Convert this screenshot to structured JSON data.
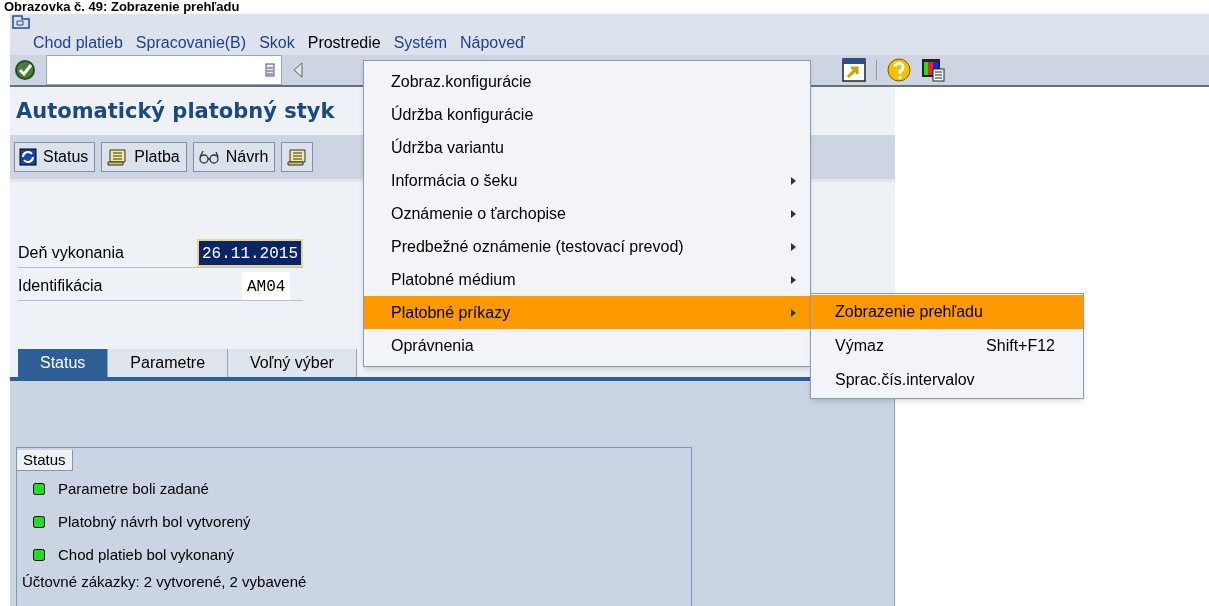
{
  "caption": "Obrazovka č. 49: Zobrazenie prehľadu",
  "menubar": [
    {
      "label": "Chod platieb",
      "selected": false
    },
    {
      "label": "Spracovanie(B)",
      "selected": false
    },
    {
      "label": "Skok",
      "selected": false
    },
    {
      "label": "Prostredie",
      "selected": true
    },
    {
      "label": "Systém",
      "selected": false
    },
    {
      "label": "Nápoveď",
      "selected": false
    }
  ],
  "title": "Automatický platobný styk",
  "buttons": [
    {
      "kind": "refresh",
      "label": "Status"
    },
    {
      "kind": "scroll",
      "label": "Platba"
    },
    {
      "kind": "glasses",
      "label": "Návrh"
    },
    {
      "kind": "scroll"
    }
  ],
  "fields": [
    {
      "label": "Deň vykonania",
      "value": "26.11.2015",
      "selected": true
    },
    {
      "label": "Identifikácia",
      "value": "AM04",
      "selected": false
    }
  ],
  "tabs": [
    {
      "label": "Status",
      "selected": true
    },
    {
      "label": "Parametre",
      "selected": false
    },
    {
      "label": "Voľný výber",
      "selected": false
    }
  ],
  "status_group": {
    "title": "Status",
    "items": [
      "Parametre boli zadané",
      "Platobný návrh bol vytvorený",
      "Chod platieb bol vykonaný"
    ],
    "summary": "Účtovné zákazky: 2 vytvorené, 2 vybavené"
  },
  "menu": [
    {
      "label": "Zobraz.konfigurácie",
      "submenu": false,
      "selected": false
    },
    {
      "label": "Údržba konfigurácie",
      "submenu": false,
      "selected": false
    },
    {
      "label": "Údržba variantu",
      "submenu": false,
      "selected": false
    },
    {
      "label": "Informácia o šeku",
      "submenu": true,
      "selected": false
    },
    {
      "label": "Oznámenie o ťarchopise",
      "submenu": true,
      "selected": false
    },
    {
      "label": "Predbežné oznámenie (testovací prevod)",
      "submenu": true,
      "selected": false
    },
    {
      "label": "Platobné médium",
      "submenu": true,
      "selected": false
    },
    {
      "label": "Platobné príkazy",
      "submenu": true,
      "selected": true
    },
    {
      "label": "Oprávnenia",
      "submenu": false,
      "selected": false
    }
  ],
  "submenu": [
    {
      "label": "Zobrazenie prehľadu",
      "selected": true
    },
    {
      "label": "Výmaz",
      "shortcut": "Shift+F12",
      "selected": false
    },
    {
      "label": "Sprac.čís.intervalov",
      "selected": false
    }
  ]
}
